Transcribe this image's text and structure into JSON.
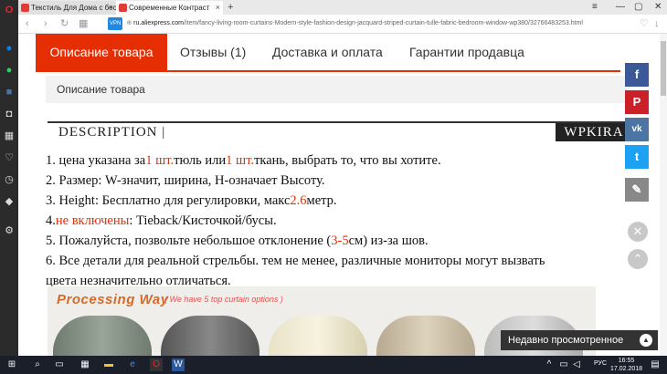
{
  "browser": {
    "tabs": [
      {
        "label": "Текстиль Для Дома с бес"
      },
      {
        "label": "Современные Контраст"
      }
    ],
    "new_tab": "+",
    "url_badge": "VPN",
    "url_domain": "ru.aliexpress.com",
    "url_path": "/item/fancy-living-room-curtains-Modern-style-fashion-design-jacquard-striped-curtain-tulle-fabric-bedroom-window-wp380/32766483253.html"
  },
  "page_tabs": {
    "description": "Описание товара",
    "reviews": "Отзывы (1)",
    "shipping": "Доставка и оплата",
    "guarantee": "Гарантии продавца"
  },
  "section_title": "Описание товара",
  "banner": {
    "title": "DESCRIPTION |",
    "brand": "WPKIRA"
  },
  "lines": {
    "l1a": "1. цена указана за",
    "l1b": "1 шт.",
    "l1c": "тюль или",
    "l1d": "1 шт.",
    "l1e": "ткань, выбрать то, что вы хотите.",
    "l2": "2. Размер: W-значит, ширина, H-означает Высоту.",
    "l3a": "3. Height: Бесплатно для регулировки, макс",
    "l3b": "2.6",
    "l3c": "метр.",
    "l4a": "4.",
    "l4b": "не включены",
    "l4c": ": Tieback/Кисточкой/бусы.",
    "l5a": "5. Пожалуйста, позвольте небольшое отклонение (",
    "l5b": "3-5",
    "l5c": "см) из-за шов.",
    "l6a": "6. Все детали для реальной стрельбы. тем не менее, различные мониторы могут вызвать",
    "l6b": "цвета незначительно отличаться."
  },
  "processing": {
    "title": "Processing Way",
    "subtitle": "( We have 5 top curtain options )"
  },
  "recent": "Недавно просмотренное",
  "taskbar": {
    "lang": "РУС",
    "time": "16:55",
    "date": "17.02.2018"
  },
  "colors": {
    "accent": "#e62e04",
    "facebook": "#3b5998",
    "pinterest": "#cb2027",
    "vk": "#4c75a3",
    "twitter": "#1da1f2",
    "edit": "#888888"
  }
}
